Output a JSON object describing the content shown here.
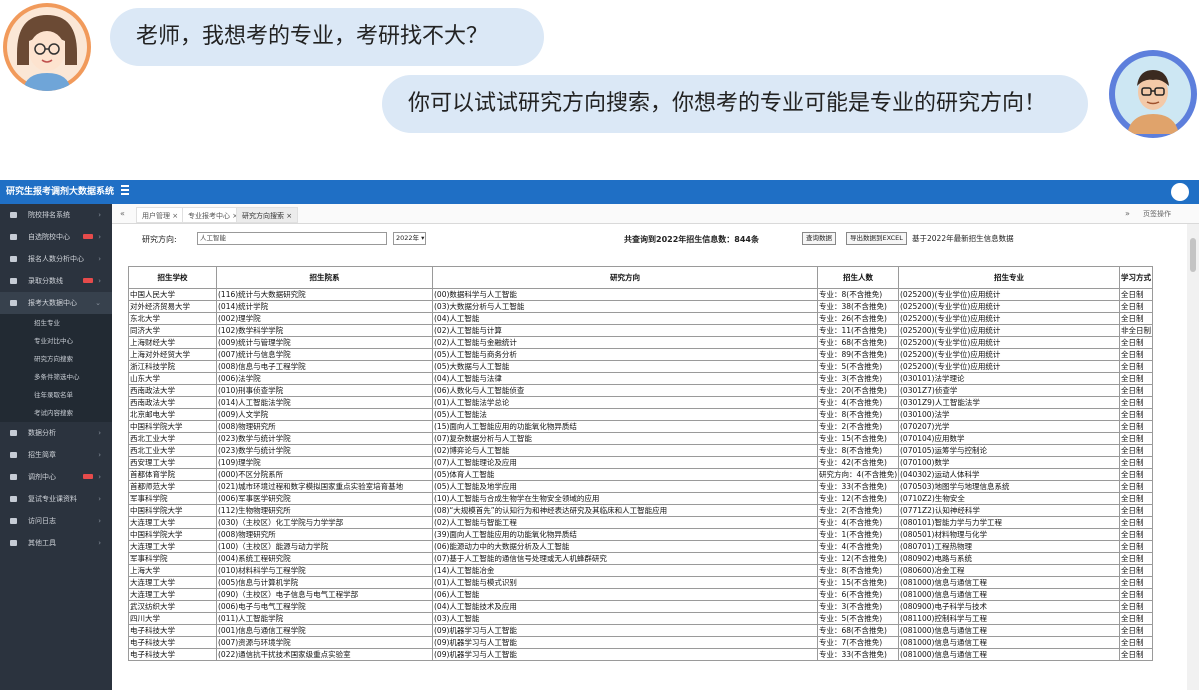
{
  "chat": {
    "question": "老师，我想考的专业，考研找不大？",
    "answer": "你可以试试研究方向搜索，你想考的专业可能是专业的研究方向！"
  },
  "app": {
    "title": "研究生报考调剂大数据系统"
  },
  "sidebar": {
    "items": [
      {
        "label": "院校排名系统",
        "icon": "monitor-icon",
        "hot": false
      },
      {
        "label": "自选院校中心",
        "icon": "gear-icon",
        "hot": true
      },
      {
        "label": "报名人数分析中心",
        "icon": "gear-icon",
        "hot": false
      },
      {
        "label": "录取分数线",
        "icon": "gear-icon",
        "hot": true
      },
      {
        "label": "报考大数据中心",
        "icon": "gear-icon",
        "hot": false,
        "expanded": true
      }
    ],
    "subitems": [
      "招生专业",
      "专业对比中心",
      "研究方向搜索",
      "多条件筛选中心",
      "往年录取名单",
      "考试内容搜索"
    ],
    "items_after": [
      {
        "label": "数据分析",
        "icon": "chart-icon",
        "hot": false
      },
      {
        "label": "招生简章",
        "icon": "gear-icon",
        "hot": false
      },
      {
        "label": "调剂中心",
        "icon": "gear-icon",
        "hot": true
      },
      {
        "label": "复试专业课资料",
        "icon": "monitor-icon",
        "hot": false
      },
      {
        "label": "访问日志",
        "icon": "monitor-icon",
        "hot": false
      },
      {
        "label": "其他工具",
        "icon": "tag-icon",
        "hot": false
      }
    ]
  },
  "tabs": {
    "items": [
      "用户管理",
      "专业报考中心",
      "研究方向搜索"
    ],
    "active_index": 2,
    "right_label": "页签操作"
  },
  "filter": {
    "label": "研究方向:",
    "input_value": "人工智能",
    "year": "2022年",
    "count_text": "共查询到2022年招生信息数：844条",
    "btn1": "查询数据",
    "btn2": "导出数据到EXCEL",
    "note": "基于2022年最新招生信息数据"
  },
  "table": {
    "headers": [
      "招生学校",
      "招生院系",
      "研究方向",
      "招生人数",
      "招生专业",
      "学习方式"
    ],
    "rows": [
      [
        "中国人民大学",
        "(116)统计与大数据研究院",
        "(00)数据科学与人工智能",
        "专业：8(不含推免)",
        "(025200)(专业学位)应用统计",
        "全日制"
      ],
      [
        "对外经济贸易大学",
        "(014)统计学院",
        "(03)大数据分析与人工智能",
        "专业：38(不含推免)",
        "(025200)(专业学位)应用统计",
        "全日制"
      ],
      [
        "东北大学",
        "(002)理学院",
        "(04)人工智能",
        "专业：26(不含推免)",
        "(025200)(专业学位)应用统计",
        "全日制"
      ],
      [
        "同济大学",
        "(102)数学科学学院",
        "(02)人工智能与计算",
        "专业：11(不含推免)",
        "(025200)(专业学位)应用统计",
        "非全日制"
      ],
      [
        "上海财经大学",
        "(009)统计与管理学院",
        "(02)人工智能与金融统计",
        "专业：68(不含推免)",
        "(025200)(专业学位)应用统计",
        "全日制"
      ],
      [
        "上海对外经贸大学",
        "(007)统计与信息学院",
        "(05)人工智能与商务分析",
        "专业：89(不含推免)",
        "(025200)(专业学位)应用统计",
        "全日制"
      ],
      [
        "浙江科技学院",
        "(008)信息与电子工程学院",
        "(05)大数据与人工智能",
        "专业：5(不含推免)",
        "(025200)(专业学位)应用统计",
        "全日制"
      ],
      [
        "山东大学",
        "(006)法学院",
        "(04)人工智能与法律",
        "专业：3(不含推免)",
        "(030101)法学理论",
        "全日制"
      ],
      [
        "西南政法大学",
        "(010)刑事侦查学院",
        "(06)人数化与人工智能侦查",
        "专业：20(不含推免)",
        "(0301Z7)侦查学",
        "全日制"
      ],
      [
        "西南政法大学",
        "(014)人工智能法学院",
        "(01)人工智能法学总论",
        "专业：4(不含推免)",
        "(0301Z9)人工智能法学",
        "全日制"
      ],
      [
        "北京邮电大学",
        "(009)人文学院",
        "(05)人工智能法",
        "专业：8(不含推免)",
        "(030100)法学",
        "全日制"
      ],
      [
        "中国科学院大学",
        "(008)物理研究所",
        "(15)面向人工智能应用的功能氧化物异质结",
        "专业：2(不含推免)",
        "(070207)光学",
        "全日制"
      ],
      [
        "西北工业大学",
        "(023)数学与统计学院",
        "(07)复杂数据分析与人工智能",
        "专业：15(不含推免)",
        "(070104)应用数学",
        "全日制"
      ],
      [
        "西北工业大学",
        "(023)数学与统计学院",
        "(02)博弈论与人工智能",
        "专业：8(不含推免)",
        "(070105)运筹学与控制论",
        "全日制"
      ],
      [
        "西安理工大学",
        "(109)理学院",
        "(07)人工智能理论及应用",
        "专业：42(不含推免)",
        "(070100)数学",
        "全日制"
      ],
      [
        "首都体育学院",
        "(000)不区分院系所",
        "(05)体育人工智能",
        "研究方向：4(不含推免)",
        "(040302)运动人体科学",
        "全日制"
      ],
      [
        "首都师范大学",
        "(021)城市环境过程和数字模拟国家重点实验室培育基地",
        "(05)人工智能及地学应用",
        "专业：33(不含推免)",
        "(070503)地图学与地理信息系统",
        "全日制"
      ],
      [
        "军事科学院",
        "(006)军事医学研究院",
        "(10)人工智能与合成生物学在生物安全领域的应用",
        "专业：12(不含推免)",
        "(0710Z2)生物安全",
        "全日制"
      ],
      [
        "中国科学院大学",
        "(112)生物物理研究所",
        "(08)“大规模首先”的认知行为和神经表达研究及其临床和人工智能应用",
        "专业：2(不含推免)",
        "(0771Z2)认知神经科学",
        "全日制"
      ],
      [
        "大连理工大学",
        "(030)（主校区）化工学院与力学学部",
        "(02)人工智能与智能工程",
        "专业：4(不含推免)",
        "(080101)智能力学与力学工程",
        "全日制"
      ],
      [
        "中国科学院大学",
        "(008)物理研究所",
        "(39)面向人工智能应用的功能氧化物异质结",
        "专业：1(不含推免)",
        "(080501)材料物理与化学",
        "全日制"
      ],
      [
        "大连理工大学",
        "(100)（主校区）能源与动力学院",
        "(06)能源动力中的大数据分析及人工智能",
        "专业：4(不含推免)",
        "(080701)工程热物理",
        "全日制"
      ],
      [
        "军事科学院",
        "(004)系统工程研究院",
        "(07)基于人工智能的通信信号处理或无人机蜂群研究",
        "专业：12(不含推免)",
        "(080902)电路与系统",
        "全日制"
      ],
      [
        "上海大学",
        "(010)材料科学与工程学院",
        "(14)人工智能冶金",
        "专业：8(不含推免)",
        "(080600)冶金工程",
        "全日制"
      ],
      [
        "大连理工大学",
        "(005)信息与计算机学院",
        "(01)人工智能与模式识别",
        "专业：15(不含推免)",
        "(081000)信息与通信工程",
        "全日制"
      ],
      [
        "大连理工大学",
        "(090)（主校区）电子信息与电气工程学部",
        "(06)人工智能",
        "专业：6(不含推免)",
        "(081000)信息与通信工程",
        "全日制"
      ],
      [
        "武汉纺织大学",
        "(006)电子与电气工程学院",
        "(04)人工智能技术及应用",
        "专业：3(不含推免)",
        "(080900)电子科学与技术",
        "全日制"
      ],
      [
        "四川大学",
        "(011)人工智能学院",
        "(03)人工智能",
        "专业：5(不含推免)",
        "(081100)控制科学与工程",
        "全日制"
      ],
      [
        "电子科技大学",
        "(001)信息与通信工程学院",
        "(09)机器学习与人工智能",
        "专业：68(不含推免)",
        "(081000)信息与通信工程",
        "全日制"
      ],
      [
        "电子科技大学",
        "(007)资源与环境学院",
        "(09)机器学习与人工智能",
        "专业：7(不含推免)",
        "(081000)信息与通信工程",
        "全日制"
      ],
      [
        "电子科技大学",
        "(022)通信抗干扰技术国家级重点实验室",
        "(09)机器学习与人工智能",
        "专业：33(不含推免)",
        "(081000)信息与通信工程",
        "全日制"
      ]
    ]
  }
}
